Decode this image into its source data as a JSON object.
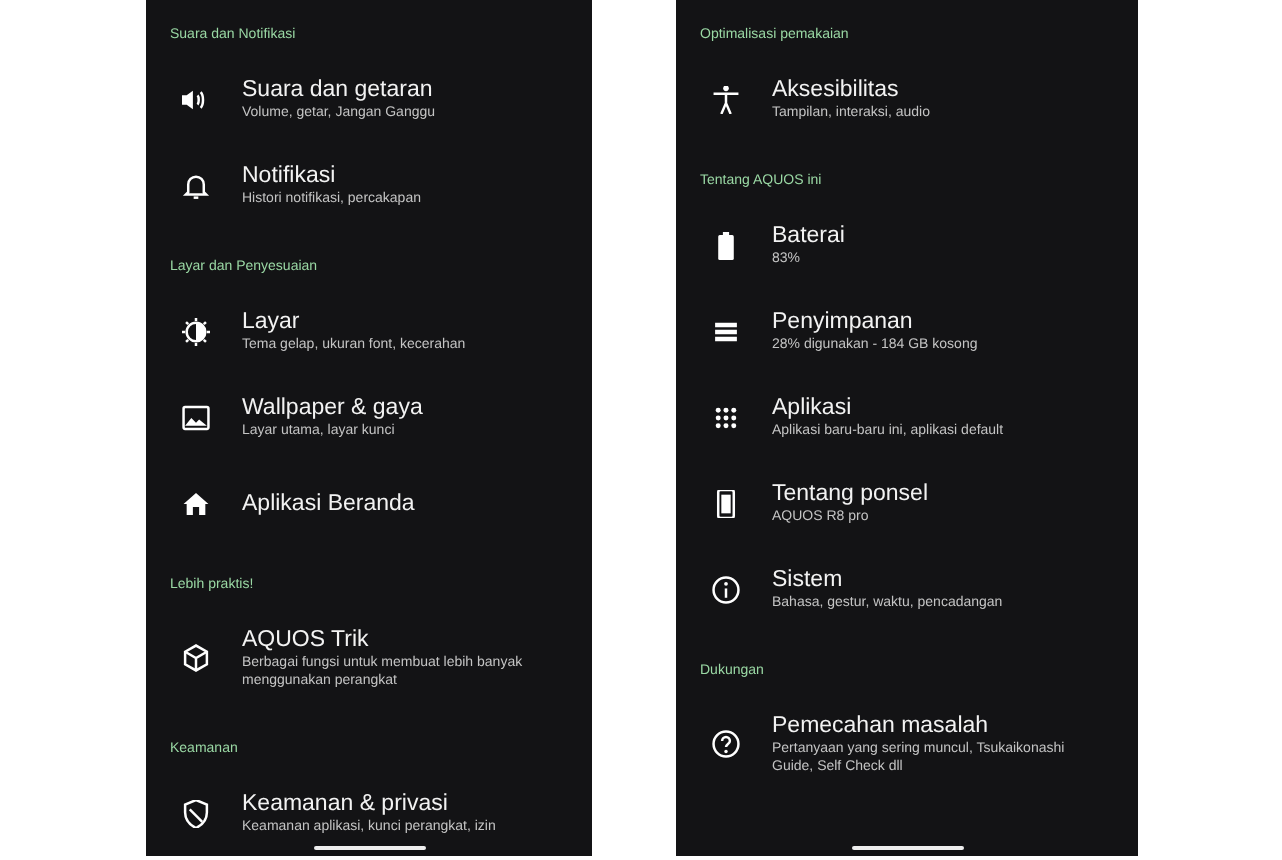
{
  "screens": [
    {
      "sections": [
        {
          "header": "Suara dan Notifikasi",
          "items": [
            {
              "title": "Suara dan getaran",
              "subtitle": "Volume, getar, Jangan Ganggu"
            },
            {
              "title": "Notifikasi",
              "subtitle": "Histori notifikasi, percakapan"
            }
          ]
        },
        {
          "header": "Layar dan Penyesuaian",
          "items": [
            {
              "title": "Layar",
              "subtitle": "Tema gelap, ukuran font, kecerahan"
            },
            {
              "title": "Wallpaper & gaya",
              "subtitle": "Layar utama, layar kunci"
            },
            {
              "title": "Aplikasi Beranda"
            }
          ]
        },
        {
          "header": "Lebih praktis!",
          "items": [
            {
              "title": "AQUOS Trik",
              "subtitle": "Berbagai fungsi untuk membuat lebih banyak menggunakan perangkat"
            }
          ]
        },
        {
          "header": "Keamanan",
          "items": [
            {
              "title": "Keamanan & privasi",
              "subtitle": "Keamanan aplikasi, kunci perangkat, izin"
            }
          ]
        }
      ]
    },
    {
      "sections": [
        {
          "header": "Optimalisasi pemakaian",
          "items": [
            {
              "title": "Aksesibilitas",
              "subtitle": "Tampilan, interaksi, audio"
            }
          ]
        },
        {
          "header": "Tentang AQUOS ini",
          "items": [
            {
              "title": "Baterai",
              "subtitle": "83%"
            },
            {
              "title": "Penyimpanan",
              "subtitle": "28% digunakan - 184 GB kosong"
            },
            {
              "title": "Aplikasi",
              "subtitle": "Aplikasi baru-baru ini, aplikasi default"
            },
            {
              "title": "Tentang ponsel",
              "subtitle": "AQUOS R8 pro"
            },
            {
              "title": "Sistem",
              "subtitle": "Bahasa, gestur, waktu, pencadangan"
            }
          ]
        },
        {
          "header": "Dukungan",
          "items": [
            {
              "title": "Pemecahan masalah",
              "subtitle": "Pertanyaan yang sering muncul, Tsukaikonashi Guide, Self Check dll"
            }
          ]
        }
      ]
    }
  ]
}
